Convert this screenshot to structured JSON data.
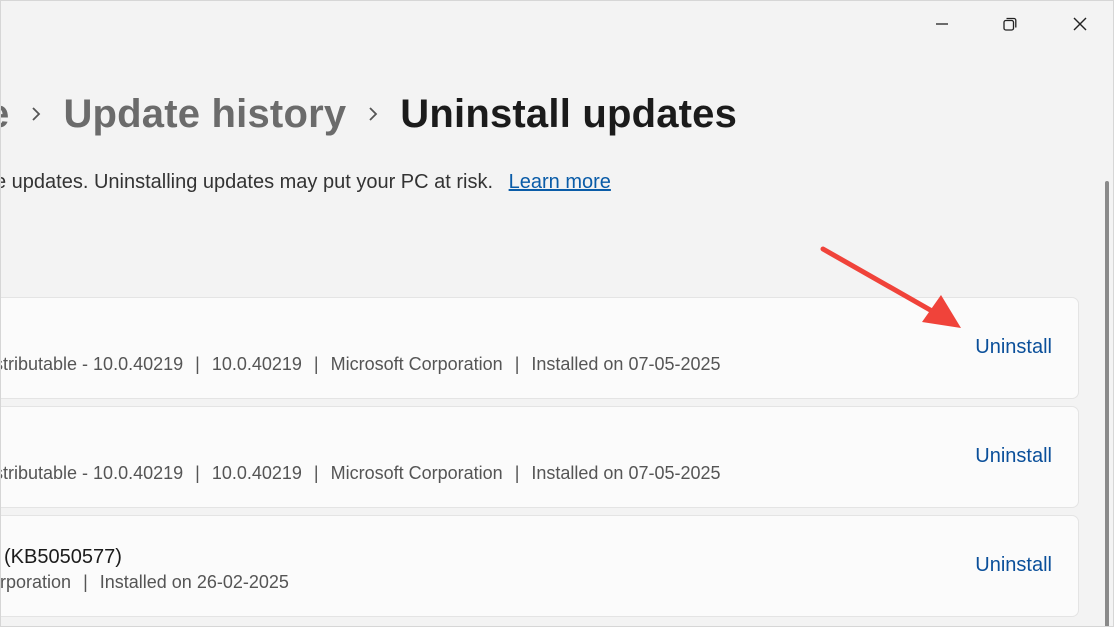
{
  "window": {
    "controls": {
      "minimize_icon": "minimize-icon",
      "maximize_icon": "restore-icon",
      "close_icon": "close-icon"
    }
  },
  "breadcrumb": {
    "items": [
      {
        "label": "e"
      },
      {
        "label": "Update history"
      },
      {
        "label": "Uninstall updates"
      }
    ]
  },
  "description": {
    "text": "e updates. Uninstalling updates may put your PC at risk.",
    "link_label": "Learn more"
  },
  "updates": [
    {
      "title": "",
      "meta": [
        "istributable - 10.0.40219",
        "10.0.40219",
        "Microsoft Corporation",
        "Installed on 07-05-2025"
      ],
      "action_label": "Uninstall"
    },
    {
      "title": "",
      "meta": [
        "istributable - 10.0.40219",
        "10.0.40219",
        "Microsoft Corporation",
        "Installed on 07-05-2025"
      ],
      "action_label": "Uninstall"
    },
    {
      "title": " (KB5050577)",
      "meta": [
        "orporation",
        "Installed on 26-02-2025"
      ],
      "action_label": "Uninstall"
    }
  ],
  "colors": {
    "accent_link": "#0a4f9a",
    "annotation_arrow": "#f0433a",
    "background": "#f3f3f3"
  }
}
